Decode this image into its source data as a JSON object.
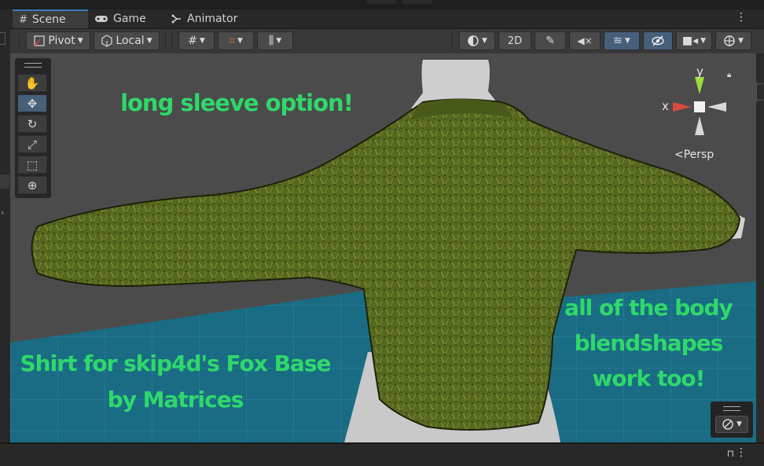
{
  "tabs": [
    {
      "label": "Scene",
      "icon": "grid-icon"
    },
    {
      "label": "Game",
      "icon": "gamepad-icon"
    },
    {
      "label": "Animator",
      "icon": "animator-icon"
    }
  ],
  "toolbar": {
    "pivot_label": "Pivot",
    "local_label": "Local",
    "mode_2d_label": "2D"
  },
  "tools": [
    "hand-tool-icon",
    "move-tool-icon",
    "rotate-tool-icon",
    "scale-tool-icon",
    "rect-tool-icon",
    "transform-tool-icon"
  ],
  "gizmo": {
    "y_label": "y",
    "x_label": "x",
    "persp_label": "Persp"
  },
  "overlay": {
    "top_text": "long sleeve option!",
    "left_text_line1": "Shirt for skip4d's Fox Base",
    "left_text_line2": "by Matrices",
    "right_text_line1": "all of the body",
    "right_text_line2": "blendshapes",
    "right_text_line3": "work too!"
  },
  "colors": {
    "overlay_text": "#2fd86a",
    "sweater": "#5b6e24",
    "floor": "#1a6e86",
    "tab_accent": "#3a79bb",
    "selected_button": "#46607c"
  }
}
